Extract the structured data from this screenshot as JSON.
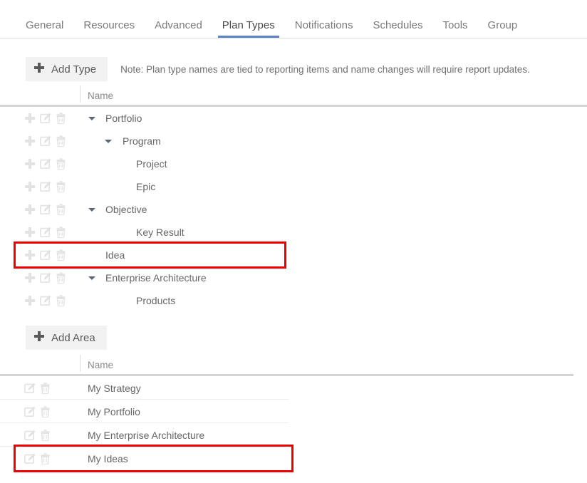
{
  "tabs": [
    {
      "label": "General",
      "active": false
    },
    {
      "label": "Resources",
      "active": false
    },
    {
      "label": "Advanced",
      "active": false
    },
    {
      "label": "Plan Types",
      "active": true
    },
    {
      "label": "Notifications",
      "active": false
    },
    {
      "label": "Schedules",
      "active": false
    },
    {
      "label": "Tools",
      "active": false
    },
    {
      "label": "Group",
      "active": false
    }
  ],
  "plan_types": {
    "add_button_label": "Add Type",
    "add_button_icon": "plus-icon",
    "note": "Note: Plan type names are tied to reporting items and name changes will require report updates.",
    "column_header_name": "Name",
    "row_icons": [
      "plus-icon",
      "edit-icon",
      "trash-icon"
    ],
    "rows": [
      {
        "label": "Portfolio",
        "indent": 0,
        "expanded": true,
        "highlighted": false
      },
      {
        "label": "Program",
        "indent": 1,
        "expanded": true,
        "highlighted": false
      },
      {
        "label": "Project",
        "indent": 2,
        "expanded": false,
        "highlighted": false
      },
      {
        "label": "Epic",
        "indent": 2,
        "expanded": false,
        "highlighted": false
      },
      {
        "label": "Objective",
        "indent": 0,
        "expanded": true,
        "highlighted": false
      },
      {
        "label": "Key Result",
        "indent": 2,
        "expanded": false,
        "highlighted": false
      },
      {
        "label": "Idea",
        "indent": 0,
        "expanded": false,
        "highlighted": true
      },
      {
        "label": "Enterprise Architecture",
        "indent": 0,
        "expanded": true,
        "highlighted": false
      },
      {
        "label": "Products",
        "indent": 2,
        "expanded": false,
        "highlighted": false
      }
    ]
  },
  "areas": {
    "add_button_label": "Add Area",
    "add_button_icon": "plus-icon",
    "column_header_name": "Name",
    "row_icons": [
      "edit-icon",
      "trash-icon"
    ],
    "rows": [
      {
        "label": "My Strategy",
        "highlighted": false
      },
      {
        "label": "My Portfolio",
        "highlighted": false
      },
      {
        "label": "My Enterprise Architecture",
        "highlighted": false
      },
      {
        "label": "My Ideas",
        "highlighted": true
      }
    ]
  },
  "colors": {
    "accent": "#5b82c4",
    "highlight": "#ee0000",
    "text": "#666666",
    "muted": "#8a8a8a",
    "icon_disabled": "#dedede",
    "button_bg": "#f2f2f2",
    "border": "#dcdcdc"
  }
}
